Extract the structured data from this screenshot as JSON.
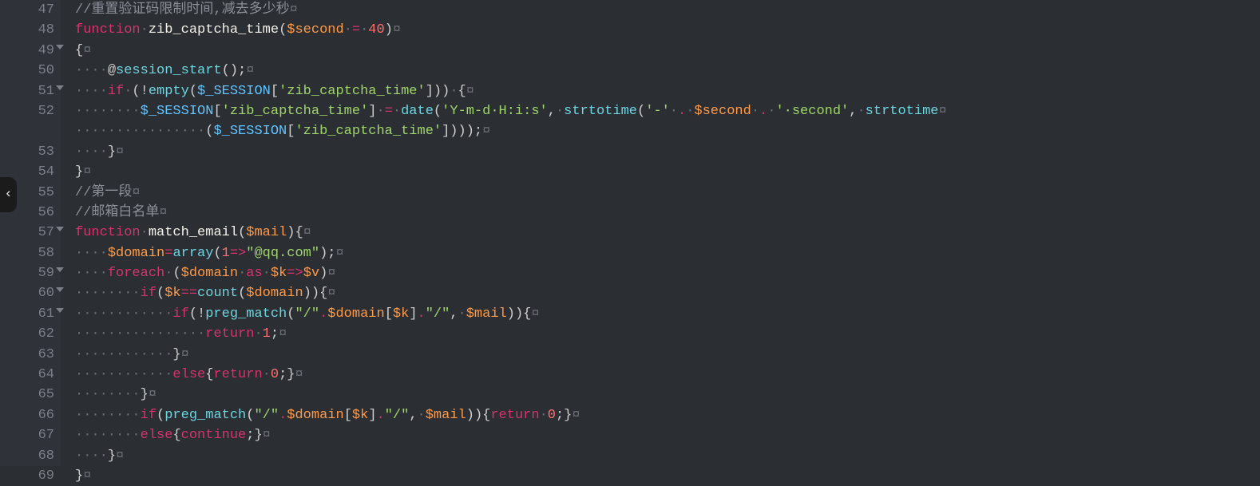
{
  "side_handle_glyph": "‹",
  "gutter": {
    "start": 47,
    "end": 69
  },
  "fold_rows": [
    49,
    51,
    57,
    59,
    60,
    61
  ],
  "code": {
    "lines": [
      {
        "n": 47,
        "t": "comment",
        "text": "//重置验证码限制时间,减去多少秒"
      },
      {
        "n": 48,
        "t": "func_decl",
        "kw": "function",
        "sp": "·",
        "name": "zib_captcha_time",
        "open": "(",
        "var": "$second",
        "sp2": "·",
        "eq": "=",
        "sp3": "·",
        "num": "40",
        "close": ")"
      },
      {
        "n": 49,
        "t": "raw",
        "segs": [
          [
            "punct",
            "{"
          ]
        ]
      },
      {
        "n": 50,
        "t": "raw",
        "indent": 4,
        "segs": [
          [
            "punct",
            "@"
          ],
          [
            "callf",
            "session_start"
          ],
          [
            "punct",
            "();"
          ]
        ]
      },
      {
        "n": 51,
        "t": "raw",
        "indent": 4,
        "segs": [
          [
            "keyword",
            "if"
          ],
          [
            "dot",
            "·"
          ],
          [
            "punct",
            "(!"
          ],
          [
            "callf",
            "empty"
          ],
          [
            "punct",
            "("
          ],
          [
            "const",
            "$_SESSION"
          ],
          [
            "punct",
            "["
          ],
          [
            "string",
            "'zib_captcha_time'"
          ],
          [
            "punct",
            "]))"
          ],
          [
            "dot",
            "·"
          ],
          [
            "punct",
            "{"
          ]
        ]
      },
      {
        "n": 52,
        "t": "raw",
        "indent": 8,
        "segs": [
          [
            "const",
            "$_SESSION"
          ],
          [
            "punct",
            "["
          ],
          [
            "string",
            "'zib_captcha_time'"
          ],
          [
            "punct",
            "]"
          ],
          [
            "dot",
            "·"
          ],
          [
            "op",
            "="
          ],
          [
            "dot",
            "·"
          ],
          [
            "callf",
            "date"
          ],
          [
            "punct",
            "("
          ],
          [
            "string",
            "'Y-m-d·H:i:s'"
          ],
          [
            "punct",
            ","
          ],
          [
            "dot",
            "·"
          ],
          [
            "callf",
            "strtotime"
          ],
          [
            "punct",
            "("
          ],
          [
            "string",
            "'-'"
          ],
          [
            "dot",
            "·"
          ],
          [
            "op",
            "."
          ],
          [
            "dot",
            "·"
          ],
          [
            "var",
            "$second"
          ],
          [
            "dot",
            "·"
          ],
          [
            "op",
            "."
          ],
          [
            "dot",
            "·"
          ],
          [
            "string",
            "'·second'"
          ],
          [
            "punct",
            ","
          ],
          [
            "dot",
            "·"
          ],
          [
            "callf",
            "strtotime"
          ]
        ]
      },
      {
        "n": "52b",
        "t": "raw",
        "indent": 16,
        "no_eol": true,
        "segs": [
          [
            "punct",
            "("
          ],
          [
            "const",
            "$_SESSION"
          ],
          [
            "punct",
            "["
          ],
          [
            "string",
            "'zib_captcha_time'"
          ],
          [
            "punct",
            "])));"
          ]
        ]
      },
      {
        "n": 53,
        "t": "raw",
        "indent": 4,
        "segs": [
          [
            "punct",
            "}"
          ]
        ]
      },
      {
        "n": 54,
        "t": "raw",
        "segs": [
          [
            "punct",
            "}"
          ]
        ]
      },
      {
        "n": 55,
        "t": "comment",
        "text": "//第一段"
      },
      {
        "n": 56,
        "t": "comment",
        "text": "//邮箱白名单"
      },
      {
        "n": 57,
        "t": "raw",
        "segs": [
          [
            "keyword",
            "function"
          ],
          [
            "dot",
            "·"
          ],
          [
            "func",
            "match_email"
          ],
          [
            "punct",
            "("
          ],
          [
            "var",
            "$mail"
          ],
          [
            "punct",
            "){"
          ]
        ]
      },
      {
        "n": 58,
        "t": "raw",
        "indent": 4,
        "segs": [
          [
            "var",
            "$domain"
          ],
          [
            "op",
            "="
          ],
          [
            "callf",
            "array"
          ],
          [
            "punct",
            "("
          ],
          [
            "num",
            "1"
          ],
          [
            "op",
            "=>"
          ],
          [
            "string",
            "\"@qq.com\""
          ],
          [
            "punct",
            ");"
          ]
        ]
      },
      {
        "n": 59,
        "t": "raw",
        "indent": 4,
        "segs": [
          [
            "keyword",
            "foreach"
          ],
          [
            "dot",
            "·"
          ],
          [
            "punct",
            "("
          ],
          [
            "var",
            "$domain"
          ],
          [
            "dot",
            "·"
          ],
          [
            "keyword",
            "as"
          ],
          [
            "dot",
            "·"
          ],
          [
            "var",
            "$k"
          ],
          [
            "op",
            "=>"
          ],
          [
            "var",
            "$v"
          ],
          [
            "punct",
            ")"
          ]
        ]
      },
      {
        "n": 60,
        "t": "raw",
        "indent": 8,
        "segs": [
          [
            "keyword",
            "if"
          ],
          [
            "punct",
            "("
          ],
          [
            "var",
            "$k"
          ],
          [
            "op",
            "=="
          ],
          [
            "callf",
            "count"
          ],
          [
            "punct",
            "("
          ],
          [
            "var",
            "$domain"
          ],
          [
            "punct",
            ")){"
          ]
        ]
      },
      {
        "n": 61,
        "t": "raw",
        "indent": 12,
        "segs": [
          [
            "keyword",
            "if"
          ],
          [
            "punct",
            "(!"
          ],
          [
            "callf",
            "preg_match"
          ],
          [
            "punct",
            "("
          ],
          [
            "string",
            "\"/\""
          ],
          [
            "op",
            "."
          ],
          [
            "var",
            "$domain"
          ],
          [
            "punct",
            "["
          ],
          [
            "var",
            "$k"
          ],
          [
            "punct",
            "]"
          ],
          [
            "op",
            "."
          ],
          [
            "string",
            "\"/\""
          ],
          [
            "punct",
            ","
          ],
          [
            "dot",
            "·"
          ],
          [
            "var",
            "$mail"
          ],
          [
            "punct",
            ")){"
          ]
        ]
      },
      {
        "n": 62,
        "t": "raw",
        "indent": 16,
        "segs": [
          [
            "keyword",
            "return"
          ],
          [
            "dot",
            "·"
          ],
          [
            "num",
            "1"
          ],
          [
            "punct",
            ";"
          ]
        ]
      },
      {
        "n": 63,
        "t": "raw",
        "indent": 12,
        "segs": [
          [
            "punct",
            "}"
          ]
        ]
      },
      {
        "n": 64,
        "t": "raw",
        "indent": 12,
        "segs": [
          [
            "keyword",
            "else"
          ],
          [
            "punct",
            "{"
          ],
          [
            "keyword",
            "return"
          ],
          [
            "dot",
            "·"
          ],
          [
            "num",
            "0"
          ],
          [
            "punct",
            ";}"
          ]
        ]
      },
      {
        "n": 65,
        "t": "raw",
        "indent": 8,
        "segs": [
          [
            "punct",
            "}"
          ]
        ]
      },
      {
        "n": 66,
        "t": "raw",
        "indent": 8,
        "segs": [
          [
            "keyword",
            "if"
          ],
          [
            "punct",
            "("
          ],
          [
            "callf",
            "preg_match"
          ],
          [
            "punct",
            "("
          ],
          [
            "string",
            "\"/\""
          ],
          [
            "op",
            "."
          ],
          [
            "var",
            "$domain"
          ],
          [
            "punct",
            "["
          ],
          [
            "var",
            "$k"
          ],
          [
            "punct",
            "]"
          ],
          [
            "op",
            "."
          ],
          [
            "string",
            "\"/\""
          ],
          [
            "punct",
            ","
          ],
          [
            "dot",
            "·"
          ],
          [
            "var",
            "$mail"
          ],
          [
            "punct",
            ")){"
          ],
          [
            "keyword",
            "return"
          ],
          [
            "dot",
            "·"
          ],
          [
            "num",
            "0"
          ],
          [
            "punct",
            ";}"
          ]
        ]
      },
      {
        "n": 67,
        "t": "raw",
        "indent": 8,
        "segs": [
          [
            "keyword",
            "else"
          ],
          [
            "punct",
            "{"
          ],
          [
            "keyword",
            "continue"
          ],
          [
            "punct",
            ";}"
          ]
        ]
      },
      {
        "n": 68,
        "t": "raw",
        "indent": 4,
        "segs": [
          [
            "punct",
            "}"
          ]
        ]
      },
      {
        "n": 69,
        "t": "raw",
        "segs": [
          [
            "punct",
            "}"
          ]
        ]
      }
    ]
  },
  "glyphs": {
    "ws": "·",
    "eol": "¤"
  }
}
